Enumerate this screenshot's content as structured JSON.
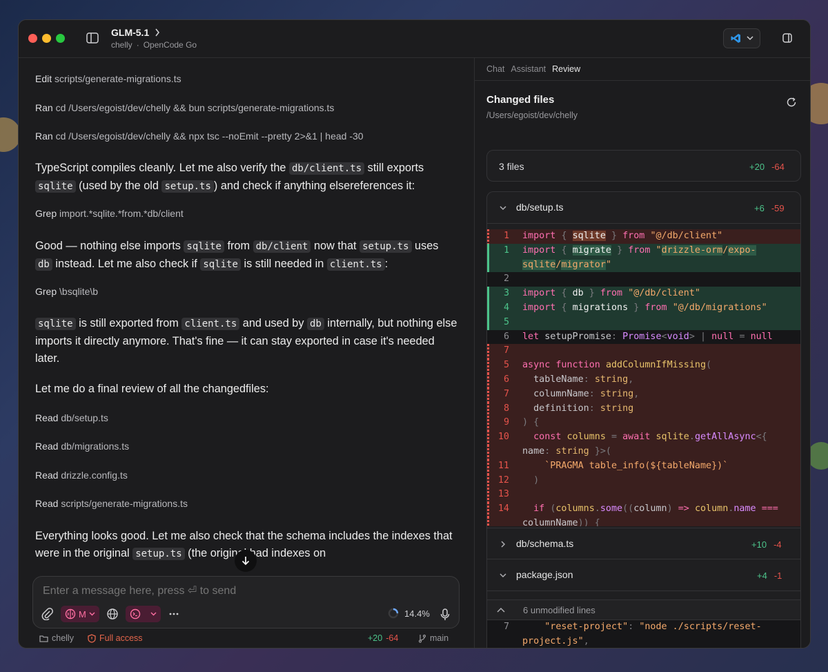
{
  "window": {
    "title": "GLM-5.1",
    "project": "chelly",
    "separator": "·",
    "provider": "OpenCode Go"
  },
  "chat": {
    "tool_calls": [
      {
        "verb": "Edit",
        "arg": "scripts/generate-migrations.ts"
      },
      {
        "verb": "Ran",
        "arg": "cd /Users/egoist/dev/chelly && bun scripts/generate-migrations.ts"
      },
      {
        "verb": "Ran",
        "arg": "cd /Users/egoist/dev/chelly && npx tsc --noEmit --pretty 2>&1 | head -30"
      },
      {
        "verb": "Grep",
        "arg": "import.*sqlite.*from.*db/client"
      },
      {
        "verb": "Grep",
        "arg": "\\bsqlite\\b"
      },
      {
        "verb": "Read",
        "arg": "db/setup.ts"
      },
      {
        "verb": "Read",
        "arg": "db/migrations.ts"
      },
      {
        "verb": "Read",
        "arg": "drizzle.config.ts"
      },
      {
        "verb": "Read",
        "arg": "scripts/generate-migrations.ts"
      }
    ],
    "p1": {
      "a": "TypeScript compiles cleanly. Let me also verify the ",
      "c1": "db/client.ts",
      "b": " still exports ",
      "c2": "sqlite",
      "d": " (used by the old ",
      "c3": "setup.ts",
      "e": ") and check if anything elsereferences it:"
    },
    "p2": {
      "a": "Good — nothing else imports ",
      "c1": "sqlite",
      "b": " from ",
      "c2": "db/client",
      "d": " now that ",
      "c3": "setup.ts",
      "e": " uses ",
      "c4": "db",
      "f": " instead. Let me also check if ",
      "c5": "sqlite",
      "g": " is still needed in ",
      "c6": "client.ts",
      "h": ":"
    },
    "p3": {
      "c1": "sqlite",
      "a": " is still exported from ",
      "c2": "client.ts",
      "b": " and used by ",
      "c3": "db",
      "d": " internally, but nothing else imports it directly anymore. That's fine — it can stay exported in case it's needed later."
    },
    "p4": "Let me do a final review of all the changedfiles:",
    "p5": {
      "a": "Everything looks good. Let me also check that the schema includes the indexes that were in the original ",
      "c1": "setup.ts",
      "b": " (the original had indexes on"
    }
  },
  "composer": {
    "placeholder": "Enter a message here, press ⏎ to send",
    "model_pill": "M",
    "context_usage": "14.4%"
  },
  "statusbar": {
    "project": "chelly",
    "access": "Full access",
    "additions": "+20",
    "deletions": "-64",
    "branch": "main"
  },
  "review": {
    "tabs": [
      {
        "label": "Chat",
        "active": false
      },
      {
        "label": "Assistant",
        "active": false
      },
      {
        "label": "Review",
        "active": true
      }
    ],
    "title": "Changed files",
    "path": "/Users/egoist/dev/chelly",
    "summary": {
      "count": "3 files",
      "additions": "+20",
      "deletions": "-64"
    },
    "files": [
      {
        "name": "db/setup.ts",
        "additions": "+6",
        "deletions": "-59",
        "expanded": true
      },
      {
        "name": "db/schema.ts",
        "additions": "+10",
        "deletions": "-4",
        "expanded": false
      },
      {
        "name": "package.json",
        "additions": "+4",
        "deletions": "-1",
        "expanded": true
      }
    ],
    "unmodified": "6 unmodified lines",
    "colors": {
      "addition": "#4cc38a",
      "deletion": "#e5534b",
      "accent_pink": "#ff6fa2"
    }
  }
}
